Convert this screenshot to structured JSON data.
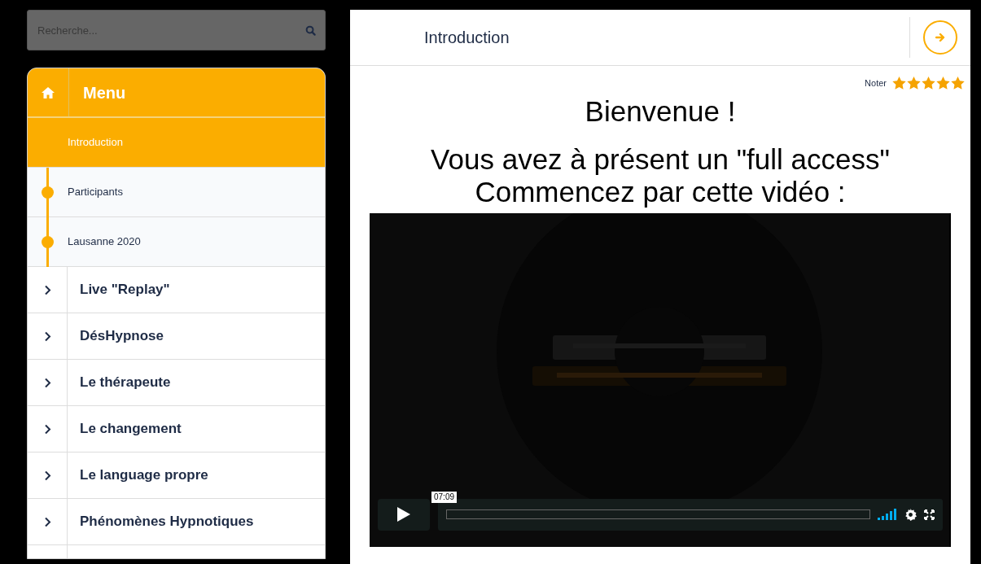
{
  "search": {
    "placeholder": "Recherche..."
  },
  "menu": {
    "title": "Menu",
    "lessons": [
      {
        "label": "Introduction",
        "selected": true
      },
      {
        "label": "Participants",
        "selected": false
      },
      {
        "label": "Lausanne 2020",
        "selected": false
      }
    ],
    "sections": [
      {
        "label": "Live \"Replay\"",
        "expanded": false
      },
      {
        "label": "DésHypnose",
        "expanded": false
      },
      {
        "label": "Le thérapeute",
        "expanded": false
      },
      {
        "label": "Le changement",
        "expanded": false
      },
      {
        "label": "Le language propre",
        "expanded": false
      },
      {
        "label": "Phénomènes Hypnotiques",
        "expanded": false
      }
    ]
  },
  "lesson": {
    "title": "Introduction",
    "rating": {
      "label": "Noter",
      "stars": 5
    },
    "heading": "Bienvenue !",
    "intro_lines": [
      "Vous avez à présent un \"full access\"",
      "Commencez par cette vidéo :"
    ],
    "video": {
      "kind": "picture",
      "time": "07:09"
    }
  }
}
